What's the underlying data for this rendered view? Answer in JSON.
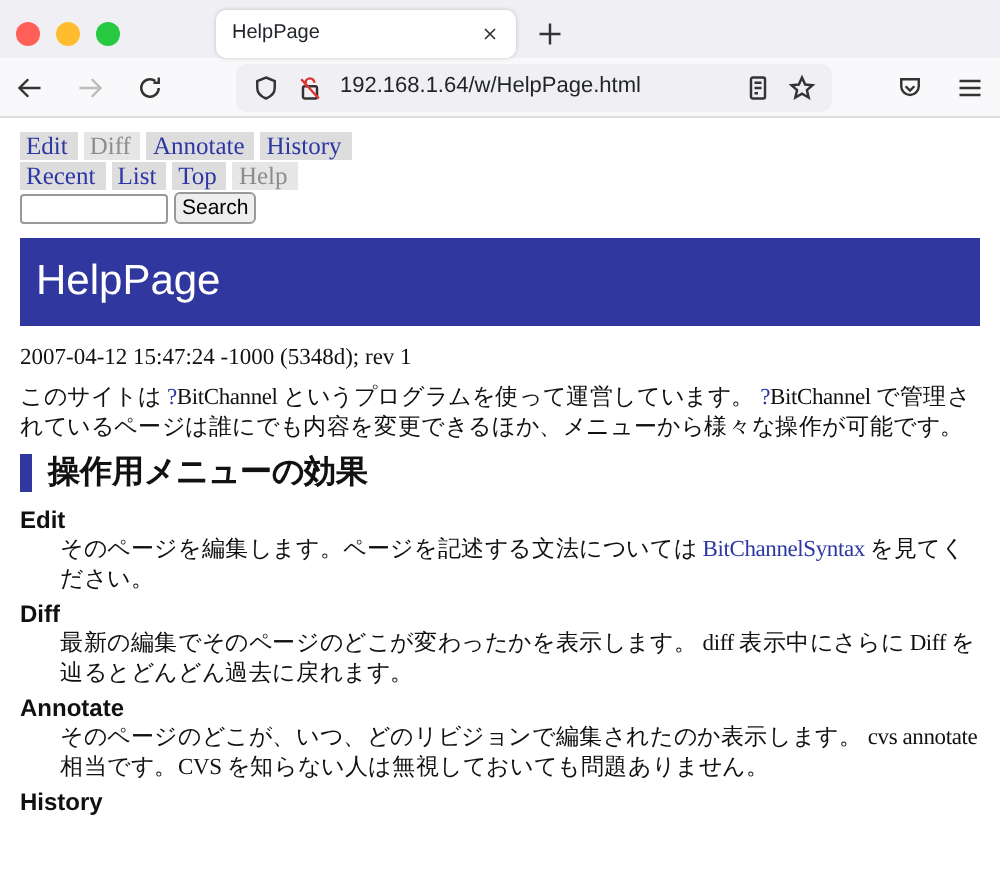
{
  "browser": {
    "tab_title": "HelpPage",
    "url": "192.168.1.64/w/HelpPage.html"
  },
  "menu": [
    [
      {
        "label": "Edit",
        "disabled": false
      },
      {
        "label": "Diff",
        "disabled": true
      },
      {
        "label": "Annotate",
        "disabled": false
      },
      {
        "label": "History",
        "disabled": false
      }
    ],
    [
      {
        "label": "Recent",
        "disabled": false
      },
      {
        "label": "List",
        "disabled": false
      },
      {
        "label": "Top",
        "disabled": false
      },
      {
        "label": "Help",
        "disabled": true
      }
    ]
  ],
  "search": {
    "button": "Search"
  },
  "page_title": "HelpPage",
  "timestamp": "2007-04-12 15:47:24 -1000 (5348d); rev 1",
  "intro": [
    {
      "text": "このサイトは "
    },
    {
      "link": "?"
    },
    {
      "text": "BitChannel というプログラムを使って運営しています。 "
    },
    {
      "link": "?"
    },
    {
      "text": "BitChannel で管理されているページは誰にでも内容を変更できるほか、メニューから様々な操作が可能です。"
    }
  ],
  "section_heading": "操作用メニューの効果",
  "terms": [
    {
      "term": "Edit",
      "definition": [
        {
          "text": "そのページを編集します。ページを記述する文法については "
        },
        {
          "link": "BitChannelSyntax"
        },
        {
          "text": " を見てください。"
        }
      ]
    },
    {
      "term": "Diff",
      "definition": [
        {
          "text": "最新の編集でそのページのどこが変わったかを表示します。 diff 表示中にさらに Diff を辿るとどんどん過去に戻れます。"
        }
      ]
    },
    {
      "term": "Annotate",
      "definition": [
        {
          "text": "そのページのどこが、いつ、どのリビジョンで編集されたのか表示します。 cvs annotate 相当です。CVS を知らない人は無視しておいても問題ありません。"
        }
      ]
    },
    {
      "term": "History"
    }
  ]
}
